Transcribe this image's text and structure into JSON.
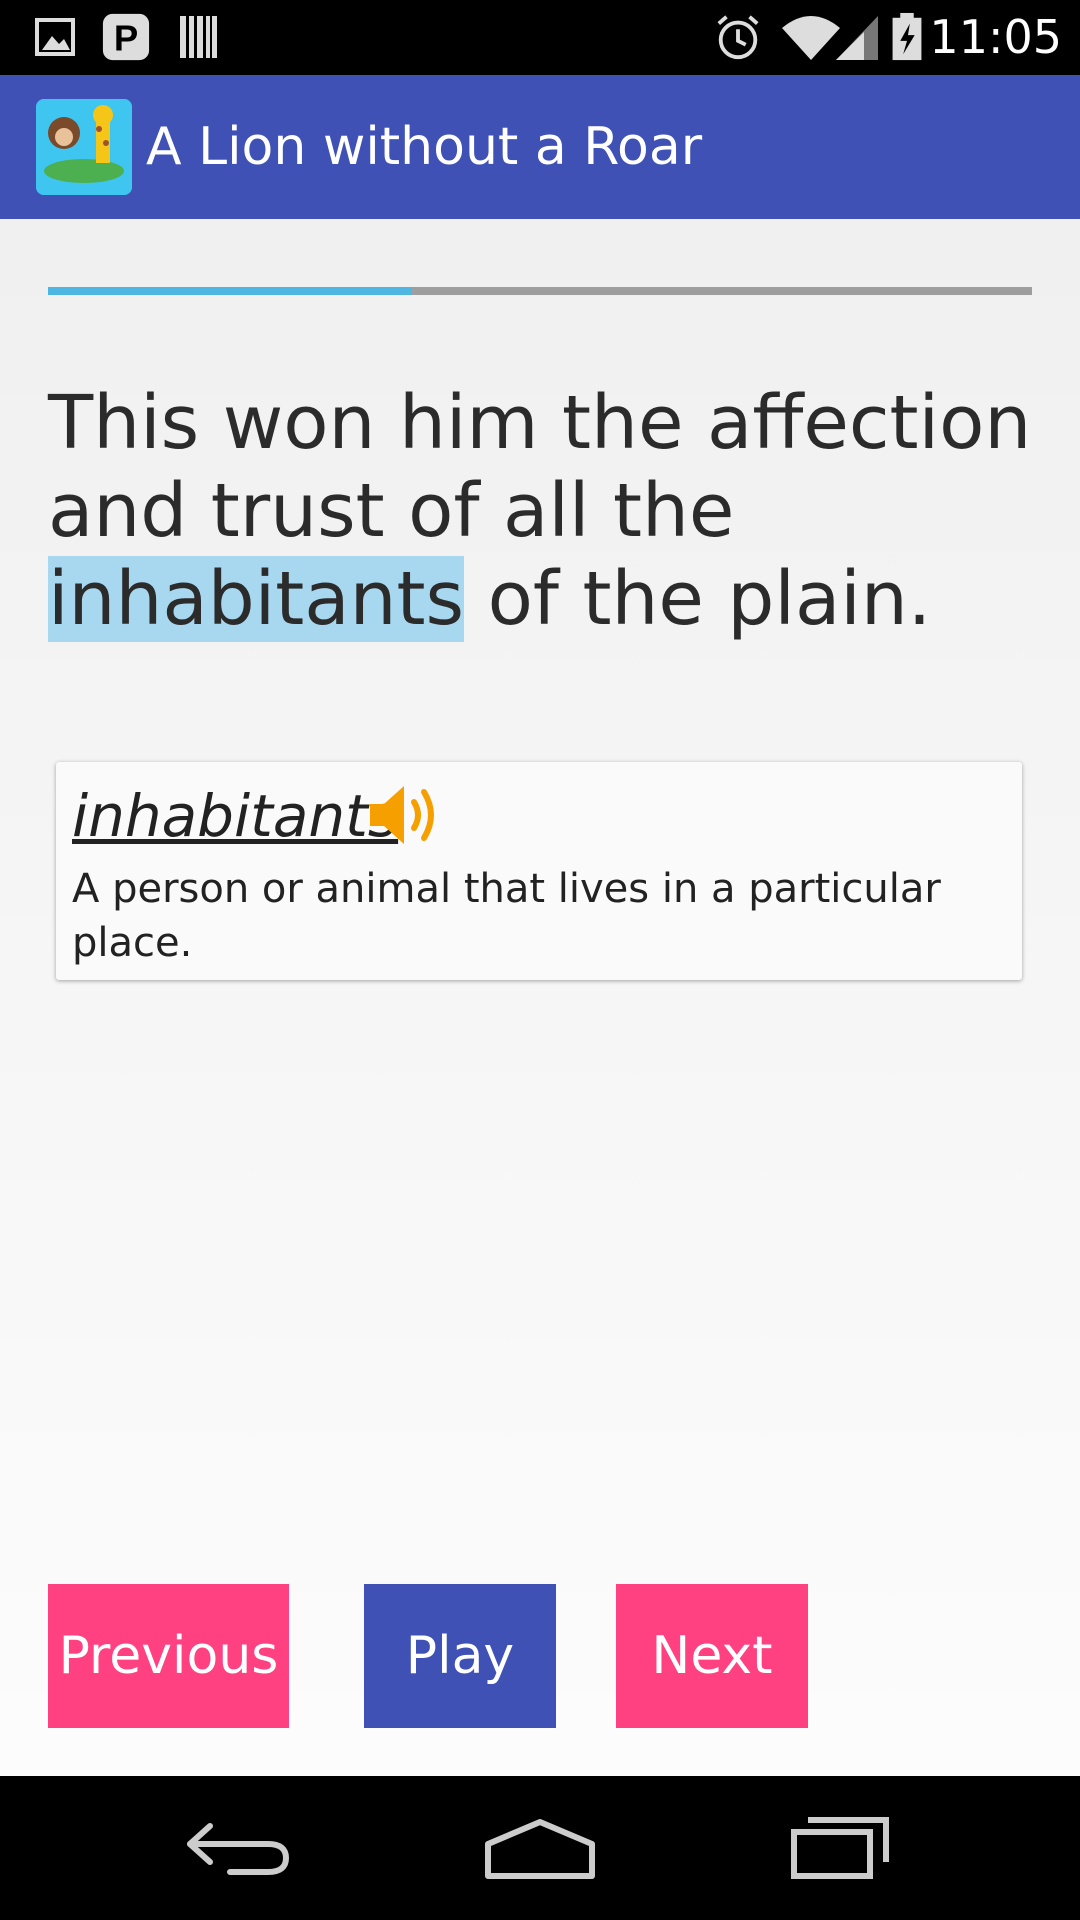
{
  "status_bar": {
    "time": "11:05",
    "left_icons": [
      "image-icon",
      "p-app-icon",
      "barcode-icon"
    ],
    "right_icons": [
      "alarm-icon",
      "wifi-icon",
      "signal-icon",
      "battery-icon"
    ]
  },
  "app_bar": {
    "title": "A Lion without a Roar",
    "icon": "animals-app-icon"
  },
  "progress": {
    "value": 0.37
  },
  "sentence": {
    "before": "This won him the affection and trust of all the ",
    "highlight": "inhabitants",
    "after": " of the plain."
  },
  "definition": {
    "word": "inhabitants",
    "text": "A person or animal that lives in a particular place.",
    "speaker_icon": "speaker-icon"
  },
  "buttons": {
    "previous": "Previous",
    "play": "Play",
    "next": "Next"
  },
  "colors": {
    "primary": "#3f51b5",
    "accent": "#ff4081",
    "highlight": "#a8d8f0",
    "speaker": "#f5a000"
  }
}
